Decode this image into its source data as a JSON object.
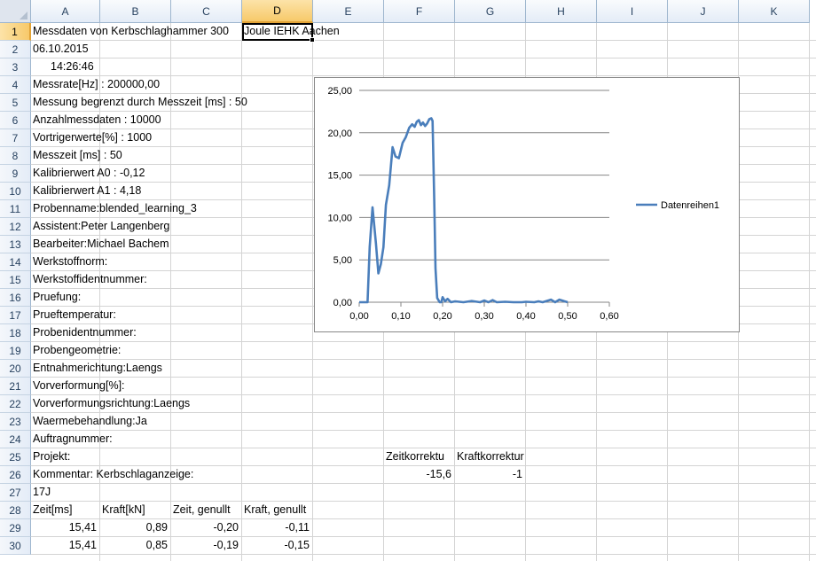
{
  "columns": [
    "A",
    "B",
    "C",
    "D",
    "E",
    "F",
    "G",
    "H",
    "I",
    "J",
    "K"
  ],
  "selected_column": "D",
  "selected_row": 1,
  "rows": [
    1,
    2,
    3,
    4,
    5,
    6,
    7,
    8,
    9,
    10,
    11,
    12,
    13,
    14,
    15,
    16,
    17,
    18,
    19,
    20,
    21,
    22,
    23,
    24,
    25,
    26,
    27,
    28,
    29,
    30
  ],
  "cells": {
    "A1": "Messdaten von Kerbschlaghammer 300",
    "D1": "Joule IEHK Aachen",
    "A2": "06.10.2015",
    "A3": "14:26:46",
    "A4": "Messrate[Hz] : 200000,00",
    "A5": "Messung begrenzt durch Messzeit [ms] : 50",
    "A6": "Anzahlmessdaten : 10000",
    "A7": "Vortrigerwerte[%] : 1000",
    "A8": "Messzeit [ms] : 50",
    "A9": "Kalibrierwert A0 : -0,12",
    "A10": "Kalibrierwert A1 : 4,18",
    "A11": "Probenname:blended_learning_3",
    "A12": "Assistent:Peter Langenberg",
    "A13": "Bearbeiter:Michael Bachem",
    "A14": "Werkstoffnorm:",
    "A15": "Werkstoffidentnummer:",
    "A16": "Pruefung:",
    "A17": "Prueftemperatur:",
    "A18": "Probenidentnummer:",
    "A19": "Probengeometrie:",
    "A20": "Entnahmerichtung:Laengs",
    "A21": "Vorverformung[%]:",
    "A22": "Vorverformungsrichtung:Laengs",
    "A23": "Waermebehandlung:Ja",
    "A24": "Auftragnummer:",
    "A25": "Projekt:",
    "F25": "Zeitkorrektu",
    "G25": "Kraftkorrektur",
    "A26": "Kommentar: Kerbschlaganzeige:",
    "F26": "-15,6",
    "G26": "-1",
    "A27": "17J",
    "A28": "Zeit[ms]",
    "B28": "Kraft[kN]",
    "C28": "Zeit, genullt",
    "D28": "Kraft, genullt",
    "A29": "15,41",
    "B29": "0,89",
    "C29": "-0,20",
    "D29": "-0,11",
    "A30": "15,41",
    "B30": "0,85",
    "C30": "-0,19",
    "D30": "-0,15"
  },
  "colors": {
    "series": "#4a7ebb",
    "gridline": "#868686",
    "header_selected": "#f7c96a"
  },
  "chart_data": {
    "type": "line",
    "series": [
      {
        "name": "Datenreihen1",
        "x": [
          0.0,
          0.02,
          0.025,
          0.032,
          0.04,
          0.046,
          0.052,
          0.058,
          0.064,
          0.072,
          0.08,
          0.087,
          0.095,
          0.104,
          0.112,
          0.12,
          0.127,
          0.133,
          0.138,
          0.143,
          0.148,
          0.153,
          0.158,
          0.163,
          0.168,
          0.173,
          0.176,
          0.18,
          0.183,
          0.187,
          0.193,
          0.197,
          0.2,
          0.206,
          0.212,
          0.22,
          0.23,
          0.25,
          0.27,
          0.29,
          0.3,
          0.31,
          0.32,
          0.33,
          0.35,
          0.37,
          0.39,
          0.4,
          0.42,
          0.43,
          0.44,
          0.46,
          0.47,
          0.48,
          0.5
        ],
        "y": [
          0.0,
          0.0,
          6.5,
          11.2,
          7.0,
          3.4,
          4.5,
          6.5,
          11.5,
          13.8,
          18.3,
          17.2,
          17.0,
          18.8,
          19.5,
          20.6,
          21.0,
          20.7,
          21.3,
          21.5,
          20.9,
          21.2,
          20.8,
          21.1,
          21.6,
          21.7,
          21.4,
          12.0,
          4.0,
          0.5,
          0.0,
          0.0,
          0.6,
          0.1,
          0.4,
          0.0,
          0.1,
          0.0,
          0.15,
          0.0,
          0.2,
          0.0,
          0.25,
          0.0,
          0.05,
          0.0,
          0.0,
          0.05,
          0.0,
          0.1,
          0.0,
          0.3,
          0.0,
          0.3,
          0.0
        ]
      }
    ],
    "xlim": [
      0,
      0.6
    ],
    "ylim": [
      0,
      25
    ],
    "xticks": [
      "0,00",
      "0,10",
      "0,20",
      "0,30",
      "0,40",
      "0,50",
      "0,60"
    ],
    "yticks": [
      "0,00",
      "5,00",
      "10,00",
      "15,00",
      "20,00",
      "25,00"
    ],
    "grid": "horizontal",
    "legend": "right"
  }
}
